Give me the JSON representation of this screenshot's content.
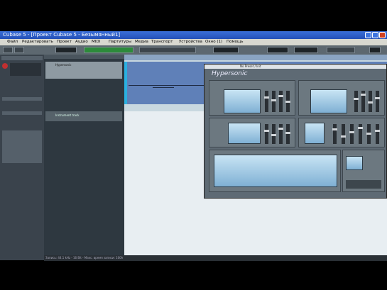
{
  "window": {
    "title": "Cubase 5 - [Проект Cubase 5 - Безымянный1]"
  },
  "menu": [
    "Файл",
    "Редактировать",
    "Проект",
    "Аудио",
    "MIDI",
    "Партитуры",
    "Медиа",
    "Транспорт",
    "Устройства",
    "Окно (1)",
    "Помощь"
  ],
  "plugin": {
    "name": "Hypersonic",
    "preset_label": "No Preset / Init"
  },
  "tracks": [
    {
      "name": "Hypersonic"
    },
    {
      "name": "Instrument track"
    }
  ],
  "status": {
    "text": "Запись: 44.1 kHz - 16 Bit - Макс. время записи: 100h"
  },
  "colors": {
    "titlebar": "#2c5cc8",
    "panel": "#6c7880",
    "project": "#c8d8e0"
  }
}
